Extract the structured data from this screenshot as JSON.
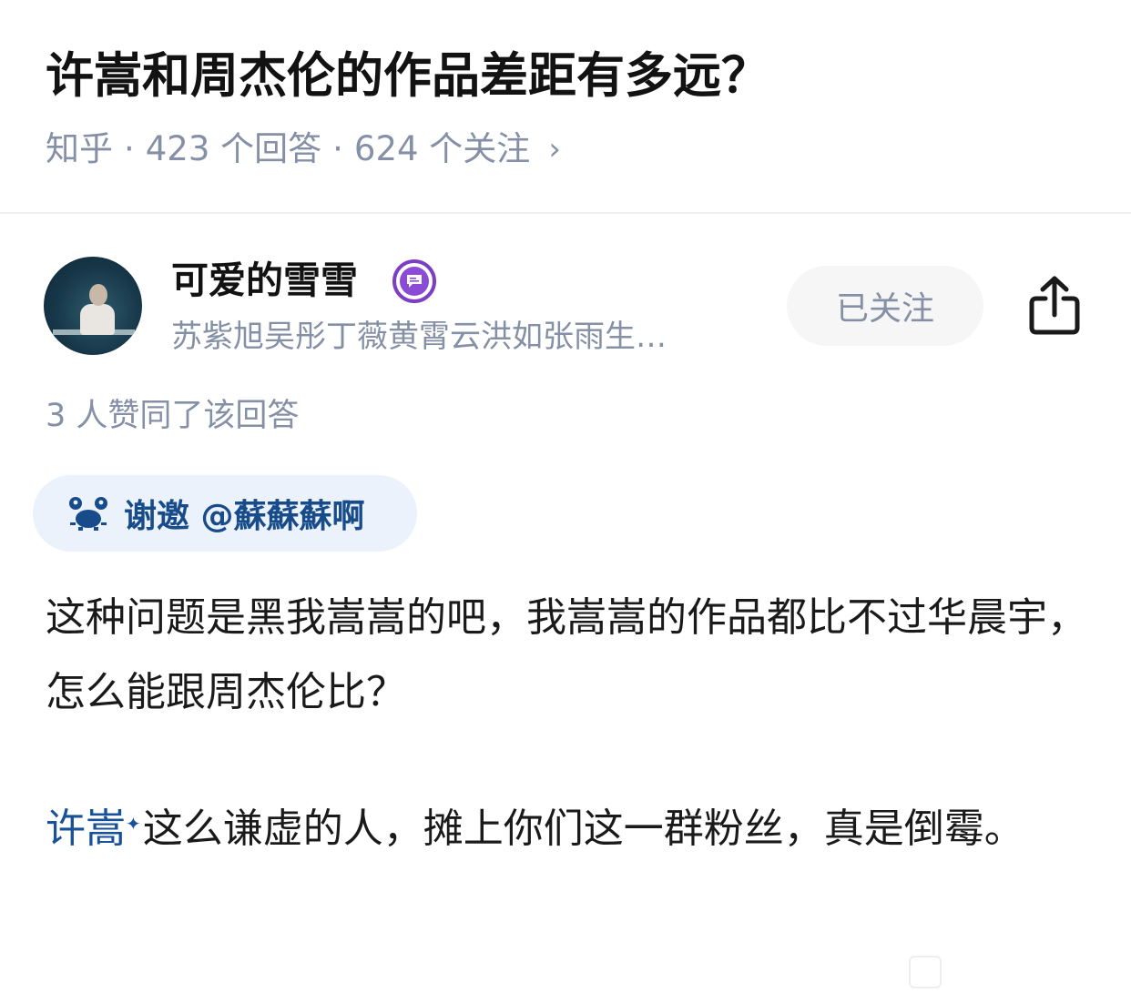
{
  "question": {
    "title": "许嵩和周杰伦的作品差距有多远？",
    "source": "知乎",
    "separator": "·",
    "answers": "423 个回答",
    "followers": "624 个关注",
    "chevron": "›"
  },
  "answer": {
    "author": {
      "name": "可爱的雪雪",
      "bio": "苏紫旭吴彤丁薇黄霄云洪如张雨生…",
      "badge_icon": "chat-badge-icon",
      "follow_label": "已关注"
    },
    "share_icon": "share-icon",
    "votes_text": "3 人赞同了该回答",
    "invite": {
      "icon": "crab-icon",
      "text": "谢邀 @蘇蘇蘇啊"
    },
    "paragraph1": "这种问题是黑我嵩嵩的吧，我嵩嵩的作品都比不过华晨宇，怎么能跟周杰伦比？",
    "paragraph2": {
      "topic_link": "许嵩",
      "spark": "✦",
      "text": "这么谦虚的人，摊上你们这一群粉丝，真是倒霉。"
    }
  },
  "colors": {
    "link": "#175199",
    "meta": "#8590a6",
    "invite_bg": "#ebf2fb",
    "badge": "#8a4bd6"
  }
}
